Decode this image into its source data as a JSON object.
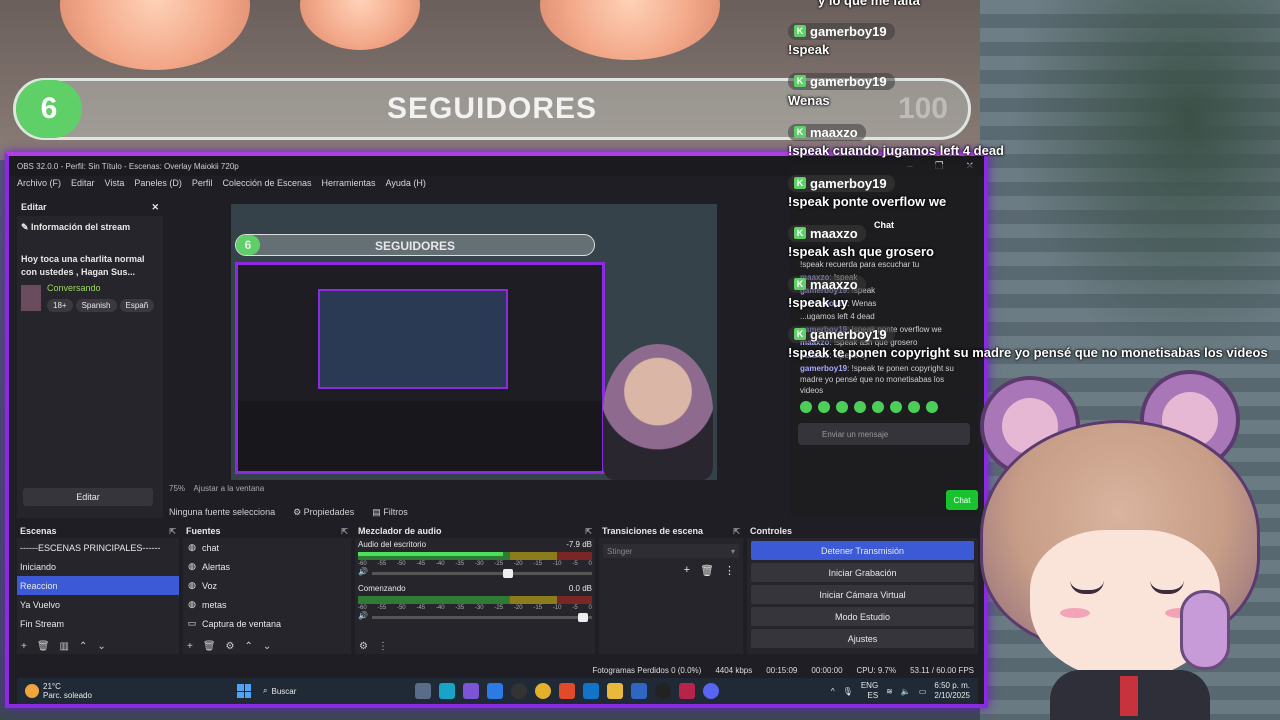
{
  "follower_goal": {
    "current": "6",
    "title": "SEGUIDORES",
    "goal": "100"
  },
  "chat_overlay": {
    "top_cutoff": "y lo que me falta",
    "messages": [
      {
        "user": "gamerboy19",
        "text": "!speak"
      },
      {
        "user": "gamerboy19",
        "text": "Wenas"
      },
      {
        "user": "maaxzo",
        "text": "!speak cuando jugamos left 4 dead"
      },
      {
        "user": "gamerboy19",
        "text": "!speak ponte overflow we"
      },
      {
        "user": "maaxzo",
        "text": "!speak ash que grosero"
      },
      {
        "user": "maaxzo",
        "text": "!speak uy"
      },
      {
        "user": "gamerboy19",
        "text": "!speak te ponen copyright su madre yo pensé que no monetisabas los videos"
      }
    ]
  },
  "obs": {
    "title": "OBS 32.0.0 - Perfil: Sin Título - Escenas: Overlay Maiokii 720p",
    "menu": [
      "Archivo (F)",
      "Editar",
      "Vista",
      "Paneles (D)",
      "Perfil",
      "Colección de Escenas",
      "Herramientas",
      "Ayuda (H)"
    ],
    "edit_dock": {
      "title": "Editar",
      "section": "Información del stream",
      "stream_title": "Hoy toca una charlita normal con ustedes , Hagan Sus...",
      "category": "Conversando",
      "tags": [
        "18+",
        "Spanish",
        "Españ"
      ],
      "button": "Editar"
    },
    "preview": {
      "count": "6",
      "title": "SEGUIDORES",
      "goal": "100"
    },
    "zoom": "75%",
    "fit": "Ajustar a la ventana",
    "source_bar": {
      "none": "Ninguna fuente selecciona",
      "properties": "Propiedades",
      "filters": "Filtros"
    },
    "scenes": {
      "title": "Escenas",
      "items": [
        "------ESCENAS PRINCIPALES------",
        "Iniciando",
        "Reaccion",
        "Ya Vuelvo",
        "Fin Stream"
      ],
      "selected": 2
    },
    "sources": {
      "title": "Fuentes",
      "items": [
        "chat",
        "Alertas",
        "Voz",
        "metas",
        "Captura de ventana"
      ]
    },
    "mixer": {
      "title": "Mezclador de audio",
      "channels": [
        {
          "name": "Audio del escritorio",
          "db": "-7.9 dB",
          "level": 0.62,
          "fader": 0.62
        },
        {
          "name": "Comenzando",
          "db": "0.0 dB",
          "level": 0.0,
          "fader": 0.96
        }
      ],
      "ticks": [
        "-60",
        "-55",
        "-50",
        "-45",
        "-40",
        "-35",
        "-30",
        "-25",
        "-20",
        "-15",
        "-10",
        "-5",
        "0"
      ]
    },
    "transitions": {
      "title": "Transiciones de escena",
      "selected": "Stinger"
    },
    "controls": {
      "title": "Controles",
      "buttons": [
        "Detener Transmisión",
        "Iniciar Grabación",
        "Iniciar Cámara Virtual",
        "Modo Estudio",
        "Ajustes"
      ]
    },
    "status": {
      "dropped": "Fotogramas Perdidos 0 (0.0%)",
      "bitrate": "4404 kbps",
      "stream_time": "00:15:09",
      "rec_time": "00:00:00",
      "cpu": "CPU: 9.7%",
      "fps": "53.11 / 60.00 FPS"
    }
  },
  "taskbar": {
    "temp": "21°C",
    "weather": "Parc. soleado",
    "search": "Buscar",
    "lang": "ENG",
    "region": "ES",
    "time": "6:50 p. m.",
    "date": "2/10/2025"
  },
  "twitch_chat": {
    "header": "Chat",
    "lines": [
      {
        "user": "",
        "text": "!speak recuerda para escuchar tu"
      },
      {
        "user": "maaxzo",
        "text": "!speak"
      },
      {
        "user": "gamerboy19",
        "text": "!speak"
      },
      {
        "user": "gamerboy19",
        "text": "Wenas"
      },
      {
        "user": "",
        "text": "...ugamos left 4 dead"
      },
      {
        "user": "gamerboy19",
        "text": "!speak ponte overflow we"
      },
      {
        "user": "maaxzo",
        "text": "!speak ash que grosero"
      },
      {
        "user": "maaxzo",
        "text": "!speak uy"
      },
      {
        "user": "gamerboy19",
        "text": "!speak te ponen copyright su madre yo pensé que no monetisabas los videos"
      }
    ],
    "input_placeholder": "Enviar un mensaje",
    "send": "Chat"
  },
  "colors": {
    "accent_purple": "#8a2be2",
    "follower_green": "#5fd068",
    "obs_selection": "#3c5ad6",
    "twitch_send": "#19c22f"
  }
}
